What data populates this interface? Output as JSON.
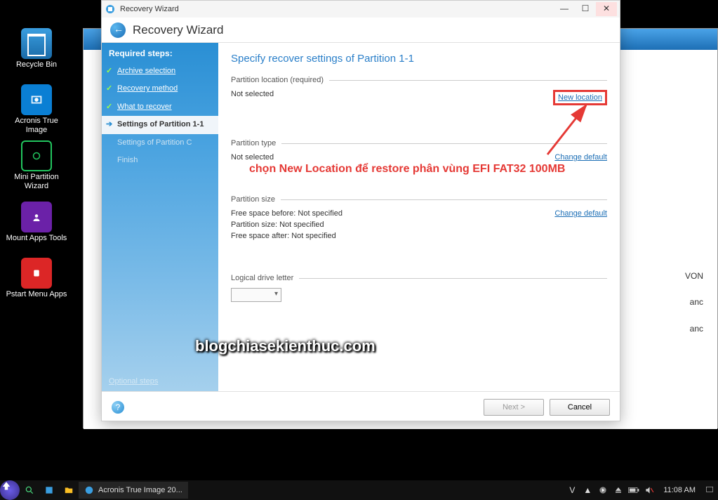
{
  "desktop": {
    "recycle": "Recycle Bin",
    "acronis": "Acronis True Image",
    "mini": "Mini Partition Wizard",
    "mount": "Mount Apps Tools",
    "pstart": "Pstart Menu Apps"
  },
  "titlebar": {
    "title": "Recovery Wizard",
    "min": "—",
    "max": "☐",
    "close": "✕"
  },
  "header": {
    "title": "Recovery Wizard"
  },
  "sidebar": {
    "required": "Required steps:",
    "steps": [
      {
        "label": "Archive selection"
      },
      {
        "label": "Recovery method"
      },
      {
        "label": "What to recover"
      },
      {
        "label": "Settings of Partition 1-1"
      },
      {
        "label": "Settings of Partition C"
      },
      {
        "label": "Finish"
      }
    ],
    "optional": "Optional steps"
  },
  "main": {
    "heading": "Specify recover settings of Partition 1-1",
    "loc": {
      "title": "Partition location (required)",
      "value": "Not selected",
      "link": "New location"
    },
    "type": {
      "title": "Partition type",
      "value": "Not selected",
      "link": "Change default"
    },
    "size": {
      "title": "Partition size",
      "before": "Free space before: Not specified",
      "psize": "Partition size: Not specified",
      "after": "Free space after: Not specified",
      "link": "Change default"
    },
    "drive": {
      "title": "Logical drive letter"
    }
  },
  "footer": {
    "help": "?",
    "next": "Next >",
    "cancel": "Cancel"
  },
  "anno": {
    "red": "chọn New Location để restore phân vùng EFI FAT32 100MB",
    "wm": "blogchiasekienthuc.com"
  },
  "bgfrag": {
    "f1": "VON",
    "f2": "anc",
    "f3": "anc"
  },
  "taskbar": {
    "task": "Acronis True Image 20...",
    "lang": "V",
    "clock": "11:08 AM"
  }
}
